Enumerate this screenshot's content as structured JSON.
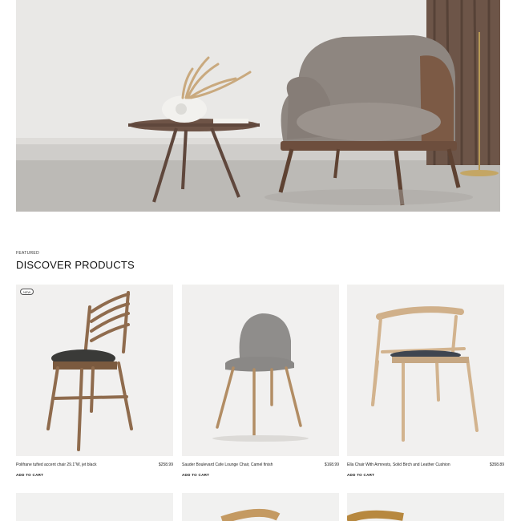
{
  "featured": {
    "eyebrow": "FEATURED",
    "title": "DISCOVER PRODUCTS"
  },
  "products": [
    {
      "badge": "NEW",
      "name": "Polifrane tufted accent chair 29.1\"W, jet black",
      "price": "$258.99",
      "cta": "ADD TO CART"
    },
    {
      "badge": "",
      "name": "Sauder Boulevard Cafe Lounge Chair, Camel finish",
      "price": "$168.99",
      "cta": "ADD TO CART"
    },
    {
      "badge": "",
      "name": "Ella Chair With Armrests, Solid Birch and Leather Cushion",
      "price": "$358.89",
      "cta": "ADD TO CART"
    }
  ]
}
